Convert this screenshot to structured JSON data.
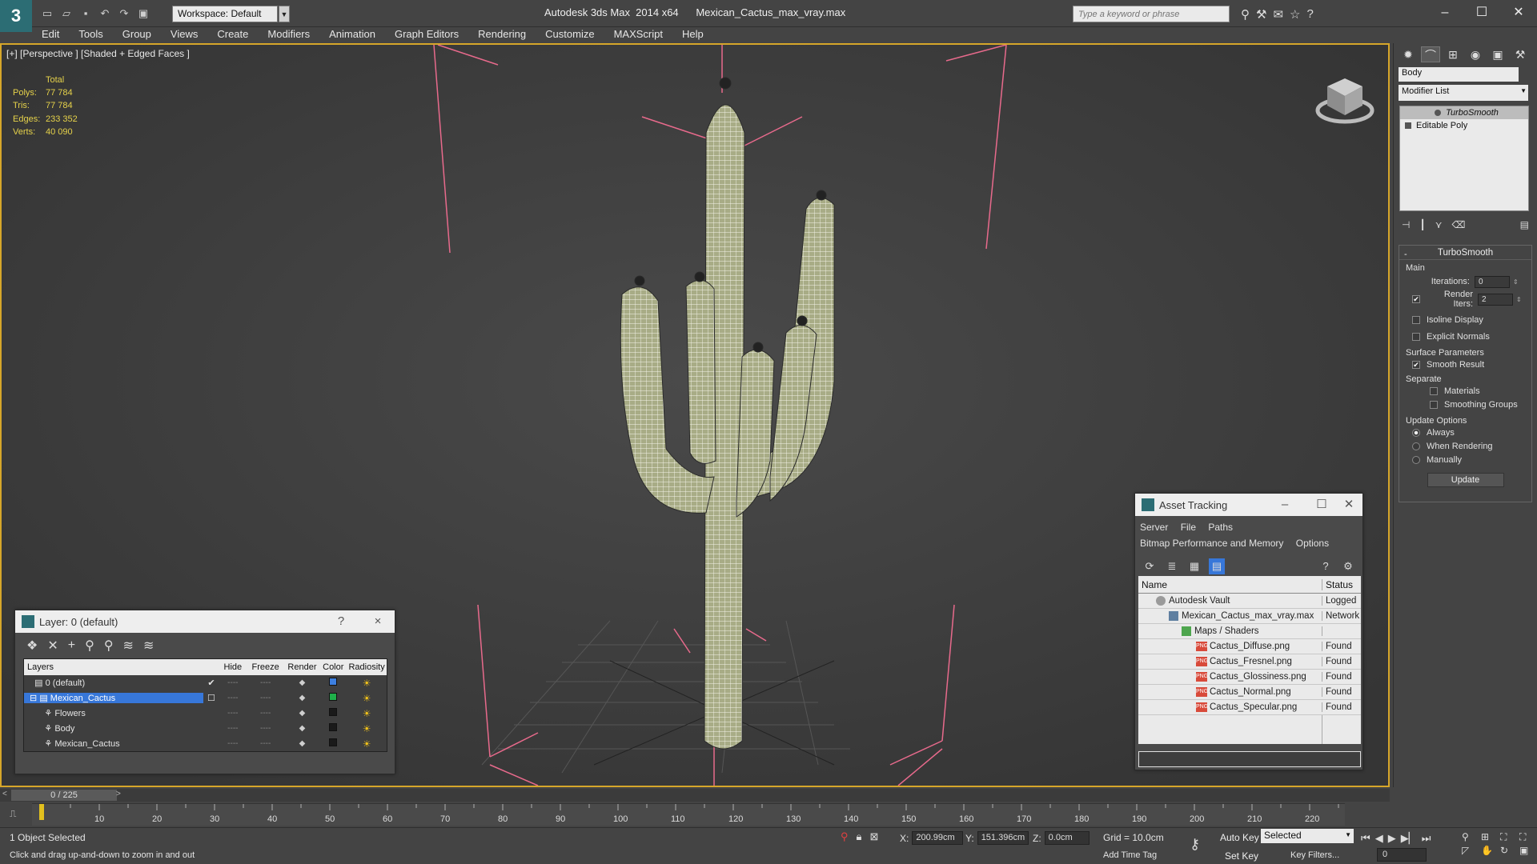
{
  "window": {
    "app_name": "Autodesk 3ds Max  2014 x64",
    "file_name": "Mexican_Cactus_max_vray.max",
    "workspace": "Workspace: Default",
    "search_placeholder": "Type a keyword or phrase"
  },
  "menu": [
    "Edit",
    "Tools",
    "Group",
    "Views",
    "Create",
    "Modifiers",
    "Animation",
    "Graph Editors",
    "Rendering",
    "Customize",
    "MAXScript",
    "Help"
  ],
  "viewport": {
    "label": "[+] [Perspective ] [Shaded + Edged Faces ]",
    "stats": {
      "header": "Total",
      "rows": [
        {
          "label": "Polys:",
          "value": "77 784"
        },
        {
          "label": "Tris:",
          "value": "77 784"
        },
        {
          "label": "Edges:",
          "value": "233 352"
        },
        {
          "label": "Verts:",
          "value": "40 090"
        }
      ]
    }
  },
  "layer_dialog": {
    "title": "Layer: 0 (default)",
    "help": "?",
    "close": "×",
    "columns": [
      "Layers",
      "Hide",
      "Freeze",
      "Render",
      "Color",
      "Radiosity"
    ],
    "rows": [
      {
        "name": "0 (default)",
        "color": "#3d7fe0",
        "active": true,
        "selected": false
      },
      {
        "name": "Mexican_Cactus",
        "color": "#1fb04a",
        "active": false,
        "selected": true
      },
      {
        "name": "Flowers",
        "color": "#1a1a1a",
        "active": false,
        "selected": false
      },
      {
        "name": "Body",
        "color": "#1a1a1a",
        "active": false,
        "selected": false
      },
      {
        "name": "Mexican_Cactus",
        "color": "#1a1a1a",
        "active": false,
        "selected": false
      }
    ]
  },
  "asset_dialog": {
    "title": "Asset Tracking",
    "menu": [
      "Server",
      "File",
      "Paths"
    ],
    "menu2": [
      "Bitmap Performance and Memory",
      "Options"
    ],
    "columns": [
      "Name",
      "Status"
    ],
    "rows": [
      {
        "name": "Autodesk Vault",
        "status": "Logged",
        "kind": "vault"
      },
      {
        "name": "Mexican_Cactus_max_vray.max",
        "status": "Network",
        "kind": "max"
      },
      {
        "name": "Maps / Shaders",
        "status": "",
        "kind": "maps"
      },
      {
        "name": "Cactus_Diffuse.png",
        "status": "Found",
        "kind": "png"
      },
      {
        "name": "Cactus_Fresnel.png",
        "status": "Found",
        "kind": "png"
      },
      {
        "name": "Cactus_Glossiness.png",
        "status": "Found",
        "kind": "png"
      },
      {
        "name": "Cactus_Normal.png",
        "status": "Found",
        "kind": "png"
      },
      {
        "name": "Cactus_Specular.png",
        "status": "Found",
        "kind": "png"
      }
    ]
  },
  "command_panel": {
    "object_name": "Body",
    "modifier_list": "Modifier List",
    "stack": [
      "TurboSmooth",
      "Editable Poly"
    ],
    "rollout_title": "TurboSmooth",
    "main_label": "Main",
    "iterations_label": "Iterations:",
    "iterations_value": "0",
    "render_iters_label": "Render Iters:",
    "render_iters_value": "2",
    "isoline": "Isoline Display",
    "explicit": "Explicit Normals",
    "surface_label": "Surface Parameters",
    "smooth_result": "Smooth Result",
    "separate_label": "Separate",
    "materials": "Materials",
    "smoothing_groups": "Smoothing Groups",
    "update_options": "Update Options",
    "always": "Always",
    "when_rendering": "When Rendering",
    "manually": "Manually",
    "update_btn": "Update"
  },
  "timeline": {
    "position": "0 / 225",
    "ticks": [
      "10",
      "20",
      "30",
      "40",
      "50",
      "60",
      "70",
      "80",
      "90",
      "100",
      "110",
      "120",
      "130",
      "140",
      "150",
      "160",
      "170",
      "180",
      "190",
      "200",
      "210",
      "220"
    ]
  },
  "status": {
    "selection": "1 Object Selected",
    "hint": "Click and drag up-and-down to zoom in and out",
    "x_label": "X:",
    "x_value": "200.99cm",
    "y_label": "Y:",
    "y_value": "151.396cm",
    "z_label": "Z:",
    "z_value": "0.0cm",
    "grid": "Grid = 10.0cm",
    "add_time_tag": "Add Time Tag",
    "auto_key": "Auto Key",
    "set_key": "Set Key",
    "selected": "Selected",
    "key_filters": "Key Filters...",
    "frame": "0"
  }
}
